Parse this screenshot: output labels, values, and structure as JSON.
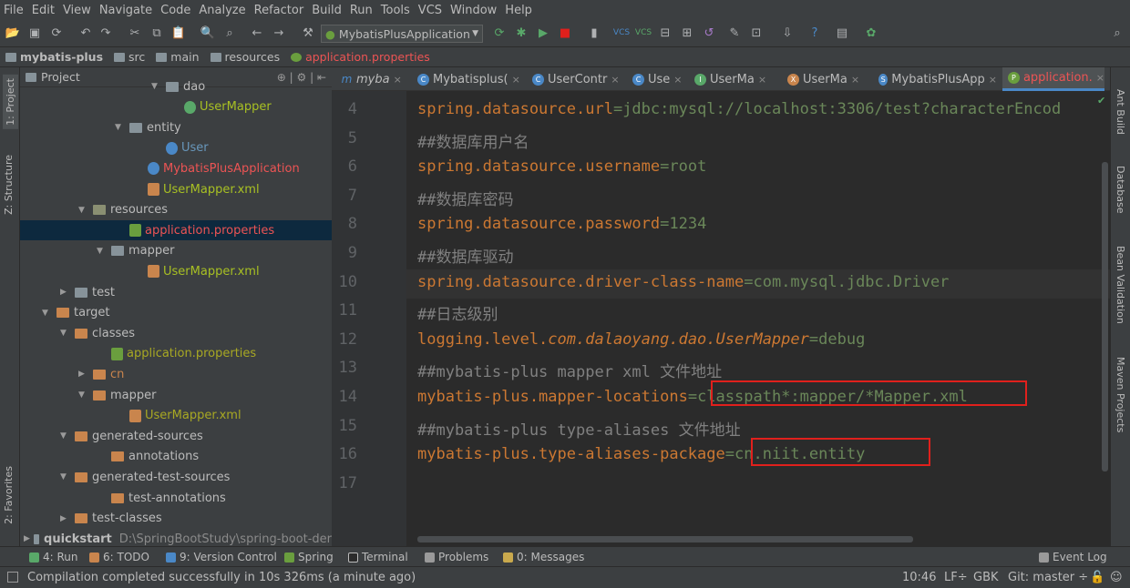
{
  "menu": [
    "File",
    "Edit",
    "View",
    "Navigate",
    "Code",
    "Analyze",
    "Refactor",
    "Build",
    "Run",
    "Tools",
    "VCS",
    "Window",
    "Help"
  ],
  "toolbar": {
    "run_config": "MybatisPlusApplication"
  },
  "breadcrumb": [
    "mybatis-plus",
    "src",
    "main",
    "resources",
    "application.properties"
  ],
  "left_tools": {
    "project": "1: Project",
    "structure": "Z: Structure",
    "favorites": "2: Favorites"
  },
  "right_tools": {
    "ant": "Ant Build",
    "database": "Database",
    "bean": "Bean Validation",
    "maven": "Maven Projects"
  },
  "project_panel": {
    "title": "Project",
    "tree": [
      {
        "label": "dao",
        "kind": "folder-blue",
        "indent": 7,
        "arrow": "▼"
      },
      {
        "label": "UserMapper",
        "kind": "interface",
        "indent": 8,
        "arrow": "",
        "color": "#a8c023"
      },
      {
        "label": "entity",
        "kind": "folder-blue",
        "indent": 5,
        "arrow": "▼"
      },
      {
        "label": "User",
        "kind": "class",
        "indent": 7,
        "arrow": "",
        "color": "#6897bb"
      },
      {
        "label": "MybatisPlusApplication",
        "kind": "class",
        "indent": 6,
        "arrow": "",
        "color": "#ec5454"
      },
      {
        "label": "UserMapper.xml",
        "kind": "xml",
        "indent": 6,
        "arrow": "",
        "color": "#a8c023"
      },
      {
        "label": "resources",
        "kind": "folder-res",
        "indent": 3,
        "arrow": "▼"
      },
      {
        "label": "application.properties",
        "kind": "props",
        "indent": 5,
        "arrow": "",
        "color": "#ec5454",
        "selected": true
      },
      {
        "label": "mapper",
        "kind": "folder-blue",
        "indent": 4,
        "arrow": "▼"
      },
      {
        "label": "UserMapper.xml",
        "kind": "xml",
        "indent": 6,
        "arrow": "",
        "color": "#a8c023"
      },
      {
        "label": "test",
        "kind": "folder-blue",
        "indent": 2,
        "arrow": "▶"
      },
      {
        "label": "target",
        "kind": "folder-orange",
        "indent": 1,
        "arrow": "▼"
      },
      {
        "label": "classes",
        "kind": "folder-orange",
        "indent": 2,
        "arrow": "▼"
      },
      {
        "label": "application.properties",
        "kind": "props",
        "indent": 4,
        "arrow": "",
        "color": "#a8a823"
      },
      {
        "label": "cn",
        "kind": "folder-orange",
        "indent": 3,
        "arrow": "▶",
        "color": "#c9854d"
      },
      {
        "label": "mapper",
        "kind": "folder-orange",
        "indent": 3,
        "arrow": "▼"
      },
      {
        "label": "UserMapper.xml",
        "kind": "xml",
        "indent": 5,
        "arrow": "",
        "color": "#a8a823"
      },
      {
        "label": "generated-sources",
        "kind": "folder-orange",
        "indent": 2,
        "arrow": "▼"
      },
      {
        "label": "annotations",
        "kind": "folder-orange",
        "indent": 4,
        "arrow": ""
      },
      {
        "label": "generated-test-sources",
        "kind": "folder-orange",
        "indent": 2,
        "arrow": "▼"
      },
      {
        "label": "test-annotations",
        "kind": "folder-orange",
        "indent": 4,
        "arrow": ""
      },
      {
        "label": "test-classes",
        "kind": "folder-orange",
        "indent": 2,
        "arrow": "▶"
      },
      {
        "label": "quickstart",
        "kind": "folder-blue",
        "indent": 0,
        "arrow": "▶",
        "bold": true,
        "path": "D:\\SpringBootStudy\\spring-boot-der"
      }
    ]
  },
  "editor_tabs": [
    {
      "label": "myba",
      "kind": "m"
    },
    {
      "label": "Mybatisplus(",
      "kind": "c"
    },
    {
      "label": "UserContr",
      "kind": "c"
    },
    {
      "label": "Use",
      "kind": "c"
    },
    {
      "label": "UserMa",
      "kind": "i"
    },
    {
      "label": "UserMa",
      "kind": "x"
    },
    {
      "label": "MybatisPlusApp",
      "kind": "s"
    },
    {
      "label": "application.",
      "kind": "p",
      "active": true
    }
  ],
  "code_lines": [
    {
      "n": "4",
      "parts": [
        {
          "t": "spring.datasource.url",
          "c": "k"
        },
        {
          "t": "=",
          "c": "v"
        },
        {
          "t": "jdbc:mysql://localhost:3306/test?characterEncod",
          "c": "v"
        }
      ]
    },
    {
      "n": "5",
      "parts": [
        {
          "t": "##数据库用户名",
          "c": "c"
        }
      ]
    },
    {
      "n": "6",
      "parts": [
        {
          "t": "spring.datasource.username",
          "c": "k"
        },
        {
          "t": "=",
          "c": "v"
        },
        {
          "t": "root",
          "c": "v"
        }
      ]
    },
    {
      "n": "7",
      "parts": [
        {
          "t": "##数据库密码",
          "c": "c"
        }
      ]
    },
    {
      "n": "8",
      "parts": [
        {
          "t": "spring.datasource.password",
          "c": "k"
        },
        {
          "t": "=",
          "c": "v"
        },
        {
          "t": "1234",
          "c": "v"
        }
      ]
    },
    {
      "n": "9",
      "parts": [
        {
          "t": "##数据库驱动",
          "c": "c"
        }
      ]
    },
    {
      "n": "10",
      "parts": [
        {
          "t": "spring.datasource.driver-class-name",
          "c": "k"
        },
        {
          "t": "=",
          "c": "v"
        },
        {
          "t": "com.mysql.jdbc.Driver",
          "c": "v"
        }
      ]
    },
    {
      "n": "11",
      "parts": [
        {
          "t": "##日志级别",
          "c": "c"
        }
      ]
    },
    {
      "n": "12",
      "parts": [
        {
          "t": "logging.level.",
          "c": "k"
        },
        {
          "t": "com.dalaoyang.dao.UserMapper",
          "c": "i"
        },
        {
          "t": "=",
          "c": "v"
        },
        {
          "t": "debug",
          "c": "v"
        }
      ]
    },
    {
      "n": "13",
      "parts": [
        {
          "t": "##mybatis-plus mapper xml 文件地址",
          "c": "c"
        }
      ]
    },
    {
      "n": "14",
      "parts": [
        {
          "t": "mybatis-plus.mapper-locations",
          "c": "k"
        },
        {
          "t": "=",
          "c": "v"
        },
        {
          "t": "classpath*:mapper/*Mapper.xml",
          "c": "v"
        }
      ]
    },
    {
      "n": "15",
      "parts": [
        {
          "t": "##mybatis-plus type-aliases 文件地址",
          "c": "c"
        }
      ]
    },
    {
      "n": "16",
      "parts": [
        {
          "t": "mybatis-plus.type-aliases-package",
          "c": "k"
        },
        {
          "t": "=",
          "c": "v"
        },
        {
          "t": "cn.niit.entity",
          "c": "v"
        }
      ]
    },
    {
      "n": "17",
      "parts": []
    }
  ],
  "bottom_tools": [
    "4: Run",
    "6: TODO",
    "9: Version Control",
    "Spring",
    "Terminal",
    "Problems",
    "0: Messages",
    "Event Log"
  ],
  "status": {
    "message": "Compilation completed successfully in 10s 326ms (a minute ago)",
    "position": "10:46",
    "line_sep": "LF÷",
    "encoding": "GBK",
    "vcs": "Git: master ÷"
  },
  "colors": {
    "accent": "#4a88c7",
    "highlight_box": "#e0201c",
    "editor_bg": "#2b2b2b",
    "panel_bg": "#3c3f41"
  }
}
